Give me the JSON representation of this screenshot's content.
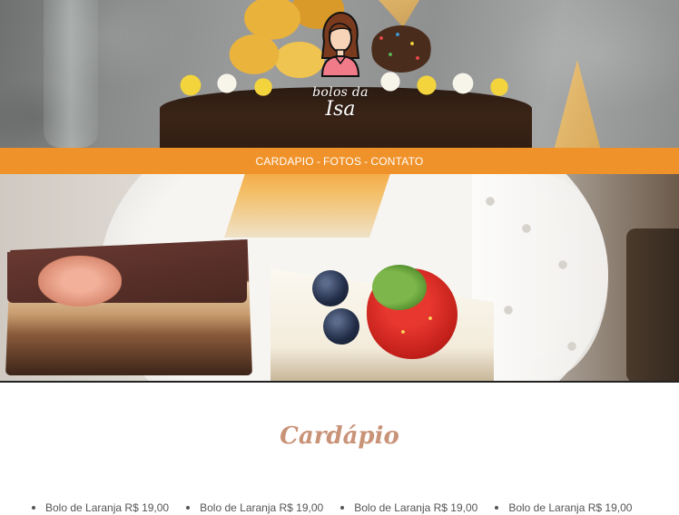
{
  "brand": {
    "line1": "bolos da",
    "line2": "Isa",
    "icon": "woman-avatar-icon"
  },
  "nav": {
    "items": [
      {
        "label": "CARDAPIO"
      },
      {
        "label": "FOTOS"
      },
      {
        "label": "CONTATO"
      }
    ],
    "separator": "-"
  },
  "colors": {
    "nav_bg": "#f0922a",
    "title": "#c99378",
    "text": "#555555"
  },
  "menu": {
    "title": "Cardápio",
    "items": [
      {
        "label": "Bolo de Laranja R$ 19,00"
      },
      {
        "label": "Bolo de Laranja R$ 19,00"
      },
      {
        "label": "Bolo de Laranja R$ 19,00"
      },
      {
        "label": "Bolo de Laranja R$ 19,00"
      }
    ]
  }
}
